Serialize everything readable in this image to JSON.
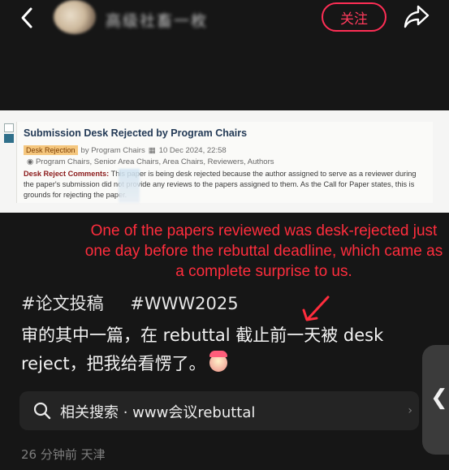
{
  "header": {
    "username": "高级社畜一枚",
    "follow_label": "关注"
  },
  "screenshot_card": {
    "title": "Submission Desk Rejected by Program Chairs",
    "tag": "Desk Rejection",
    "by": "by Program Chairs",
    "date": "10 Dec 2024, 22:58",
    "readers": "Program Chairs, Senior Area Chairs, Area Chairs, Reviewers, Authors",
    "comment_label": "Desk Reject Comments:",
    "comment_text": "This paper is being desk rejected because the author assigned to serve as a reviewer during the paper's submission did not provide any reviews to the papers assigned to them. As the Call for Paper states, this is grounds for rejecting the paper."
  },
  "annotation": {
    "text": "One of the papers reviewed was desk-rejected just one day before the rebuttal deadline, which came as a complete surprise to us."
  },
  "post": {
    "hashtags": [
      "#论文投稿",
      "#WWW2025"
    ],
    "text": "审的其中一篇，在 rebuttal 截止前一天被 desk reject，把我给看愣了。"
  },
  "related_search": {
    "label": "相关搜索 · www会议rebuttal"
  },
  "footer": {
    "meta": "26 分钟前  天津"
  },
  "colors": {
    "background": "#161616",
    "accent": "#ff2e55",
    "annotation": "#ff2d3d"
  }
}
